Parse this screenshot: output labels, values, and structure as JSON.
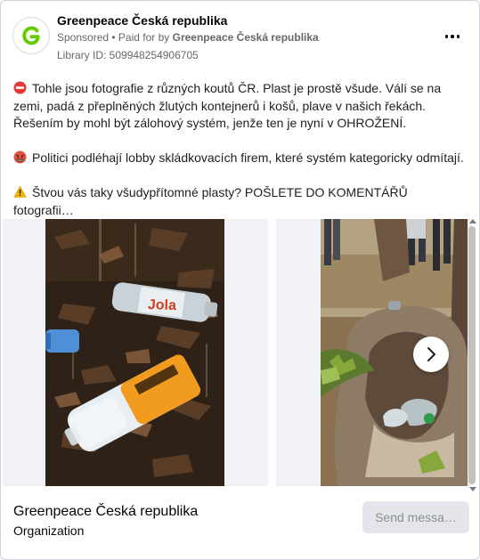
{
  "post": {
    "page_name": "Greenpeace Česká republika",
    "sponsored_label": "Sponsored",
    "separator": " • ",
    "paid_for_prefix": "Paid for by ",
    "paid_for_by": "Greenpeace Česká republika",
    "library_id": "Library ID: 509948254906705",
    "more_icon": "more-horizontal-icon",
    "avatar_icon": "greenpeace-g-logo"
  },
  "body": {
    "paragraph1": "Tohle jsou fotografie z různých koutů ČR. Plast je prostě všude. Válí se na zemi, padá z přeplněných žlutých kontejnerů i košů, plave v našich řekách. Řešením by mohl být zálohový systém, jenže ten je nyní v OHROŽENÍ.",
    "paragraph1_icon": "no-entry-emoji",
    "paragraph2": "Politici podléhají lobby skládkovacích firem, které systém kategoricky odmítají.",
    "paragraph2_icon": "angry-face-emoji",
    "paragraph3": "Štvou vás taky všudypřítomné plasty? POŠLETE DO KOMENTÁŘŮ fotografii…",
    "paragraph3_icon": "warning-emoji"
  },
  "carousel": {
    "next_icon": "chevron-right-icon"
  },
  "footer": {
    "name": "Greenpeace Česká republika",
    "type": "Organization",
    "cta_label": "Send messa…"
  },
  "colors": {
    "brand_green": "#66cc00",
    "meta_text": "#65676b",
    "cta_bg": "#e4e6eb"
  }
}
